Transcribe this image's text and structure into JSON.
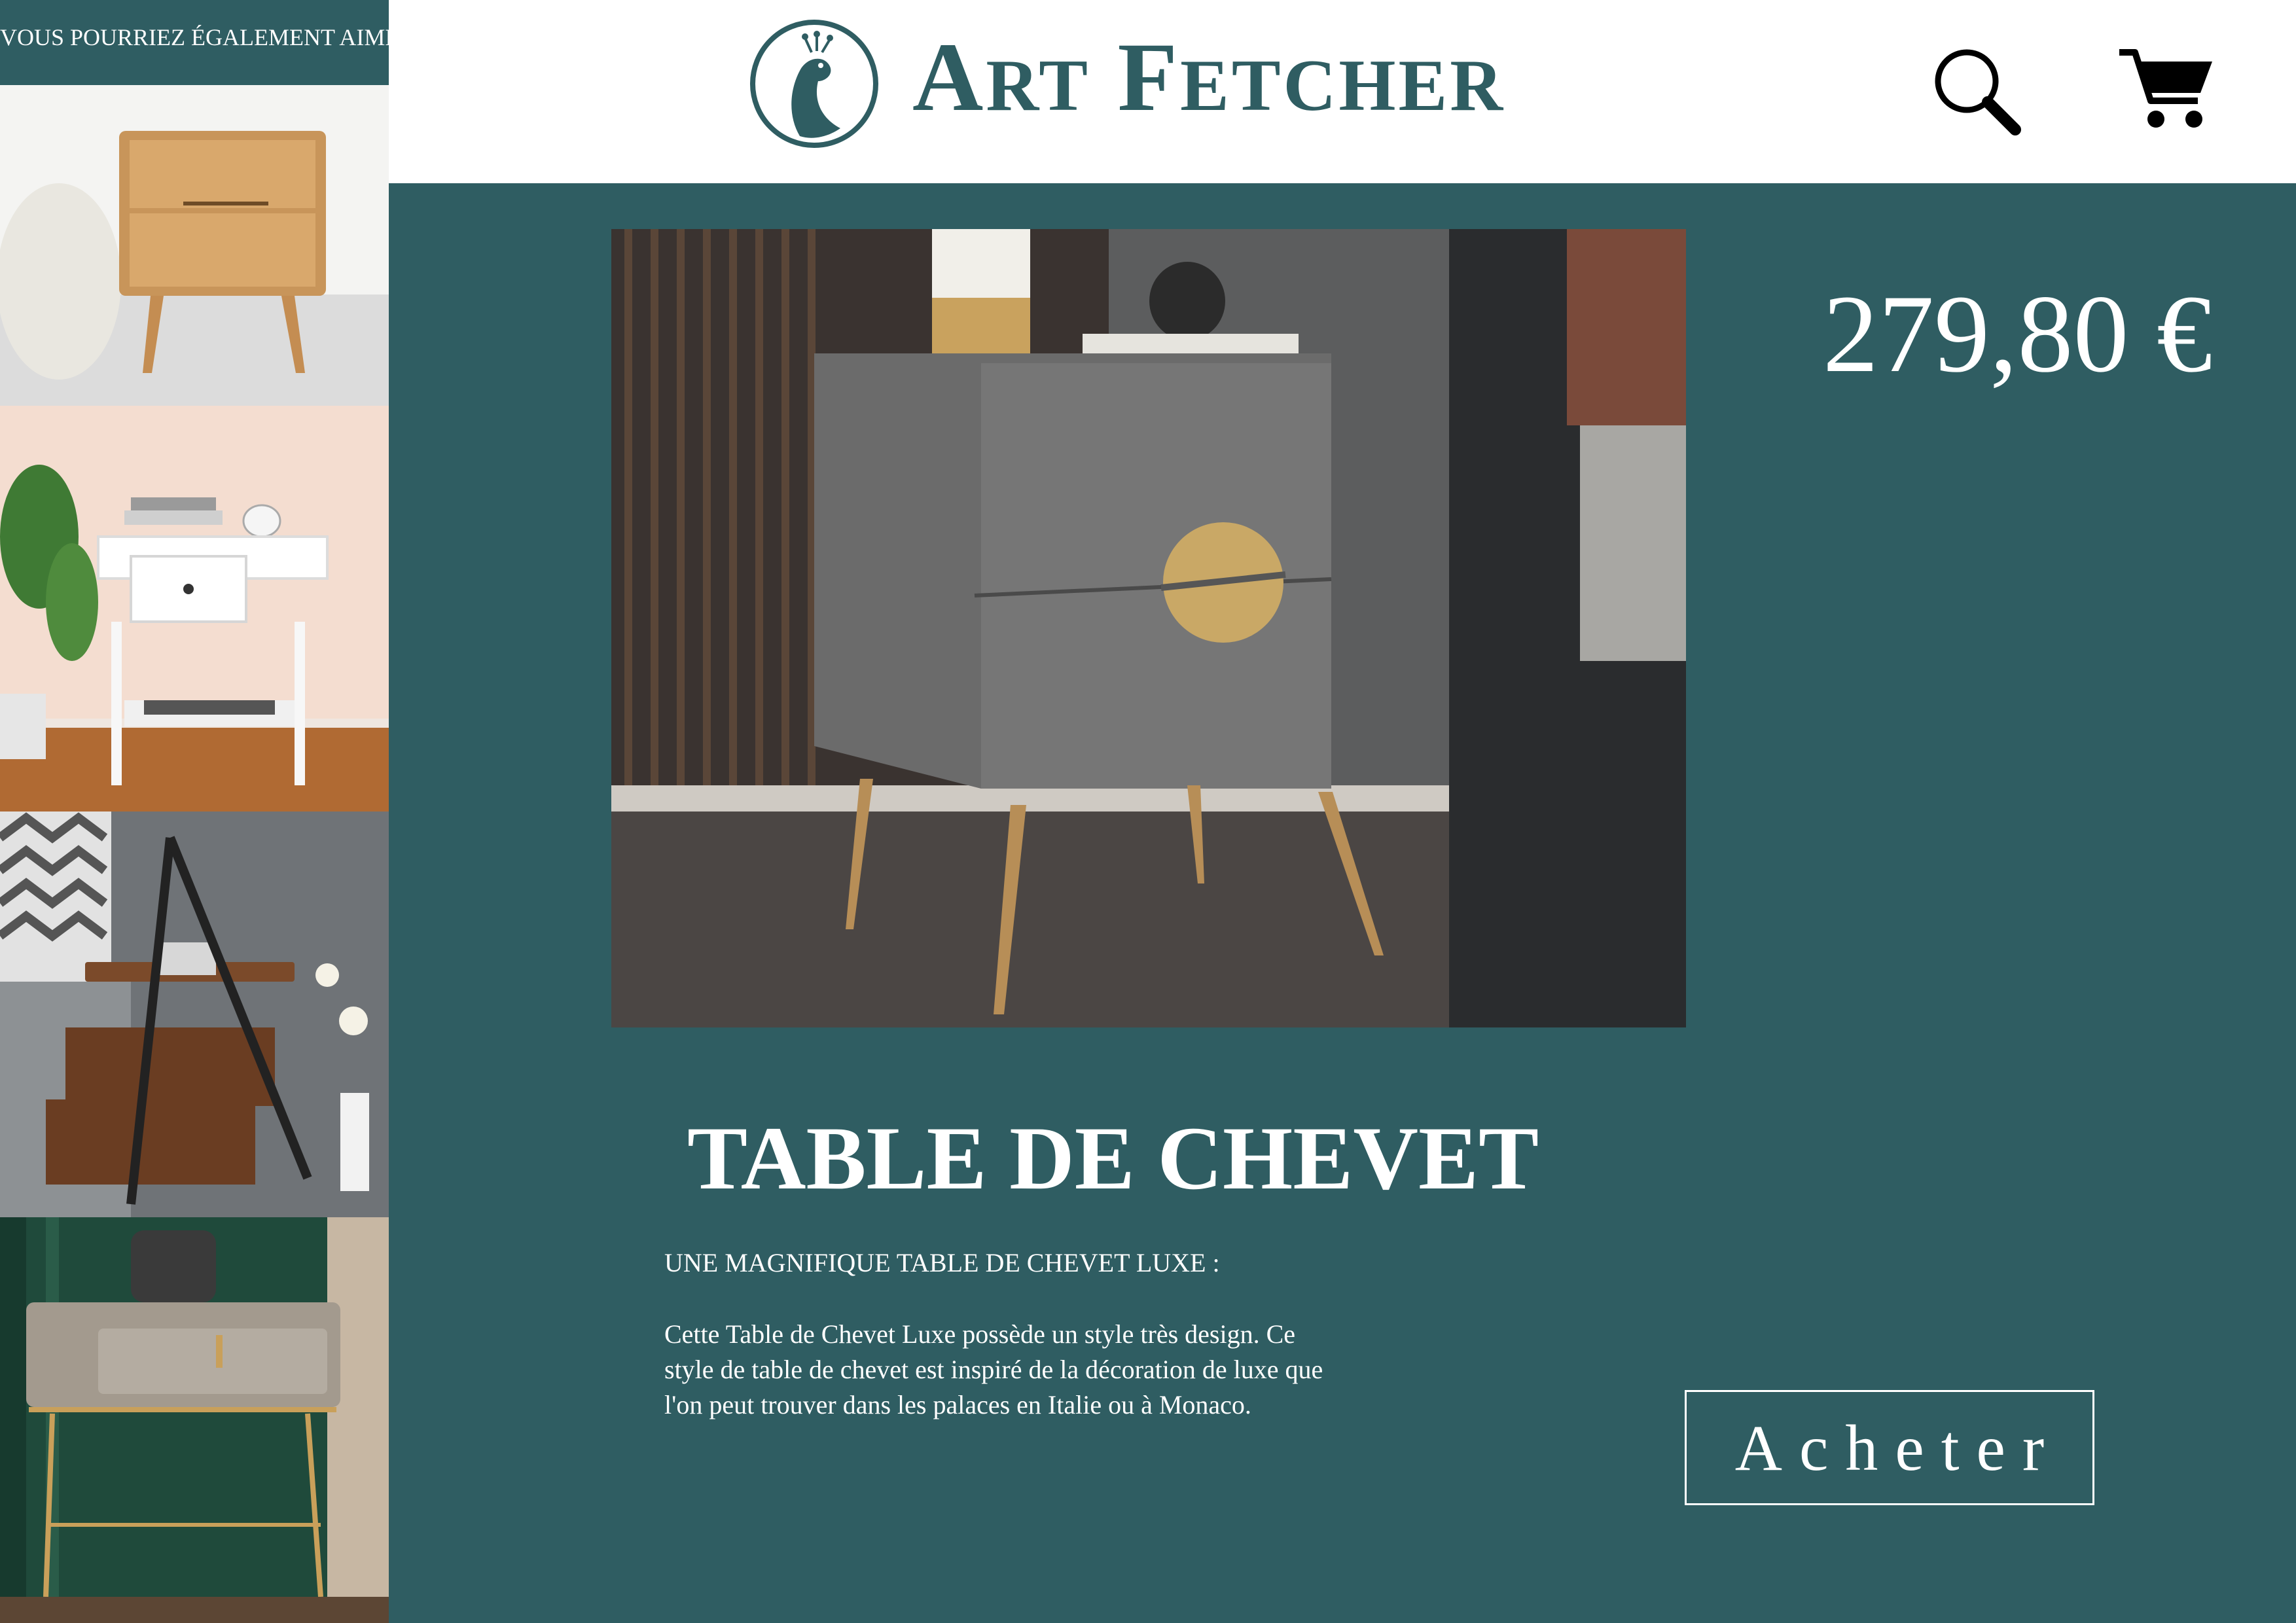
{
  "sidebar": {
    "title": "VOUS POURRIEZ ÉGALEMENT AIMER",
    "items": [
      {
        "icon": "oak-nightstand-image"
      },
      {
        "icon": "white-nightstand-image"
      },
      {
        "icon": "walnut-rolling-nightstand-image"
      },
      {
        "icon": "velvet-nightstand-image"
      }
    ]
  },
  "header": {
    "brand_first_initial": "A",
    "brand_first_rest": "RT",
    "brand_second_initial": "F",
    "brand_second_rest": "ETCHER",
    "logo_icon": "peacock-emblem-icon",
    "search_icon": "search-icon",
    "cart_icon": "cart-icon"
  },
  "product": {
    "image_icon": "grey-nightstand-gold-handle-image",
    "price": "279,80 €",
    "title": "TABLE DE CHEVET",
    "subtitle": "UNE MAGNIFIQUE TABLE DE CHEVET LUXE :",
    "description_lines": [
      "Cette Table de Chevet Luxe possède un style très design. Ce",
      "style de table de chevet est inspiré de la décoration de luxe que",
      "l'on peut trouver dans les palaces en Italie ou à Monaco."
    ],
    "buy_label": "Acheter"
  },
  "colors": {
    "brand": "#2f5d62",
    "text_on_brand": "#ffffff",
    "header_bg": "#ffffff"
  }
}
